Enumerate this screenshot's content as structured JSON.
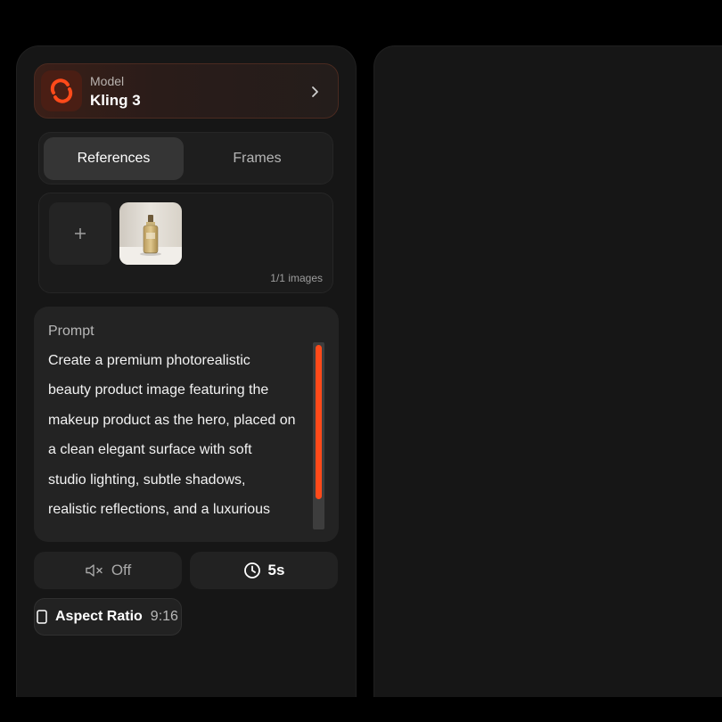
{
  "model": {
    "caption": "Model",
    "name": "Kling 3",
    "icon": "kling-logo-icon",
    "accent": "#ff4a1a"
  },
  "tabs": [
    {
      "label": "References",
      "active": true
    },
    {
      "label": "Frames",
      "active": false
    }
  ],
  "references": {
    "add_icon": "plus-icon",
    "count": "1/1 images",
    "items": [
      {
        "icon": "perfume-bottle-thumbnail"
      }
    ]
  },
  "prompt": {
    "label": "Prompt",
    "text": "Create a premium photorealistic\nbeauty product image featuring the\nmakeup product as the hero, placed on\na clean elegant surface with soft\nstudio lighting, subtle shadows,\nrealistic reflections, and a luxurious",
    "scroll_fraction": 0.85
  },
  "sound": {
    "icon": "speaker-muted-icon",
    "label": "Off"
  },
  "duration": {
    "icon": "clock-icon",
    "label": "5s"
  },
  "aspect": {
    "icon": "portrait-frame-icon",
    "label": "Aspect Ratio",
    "value": "9:16"
  }
}
